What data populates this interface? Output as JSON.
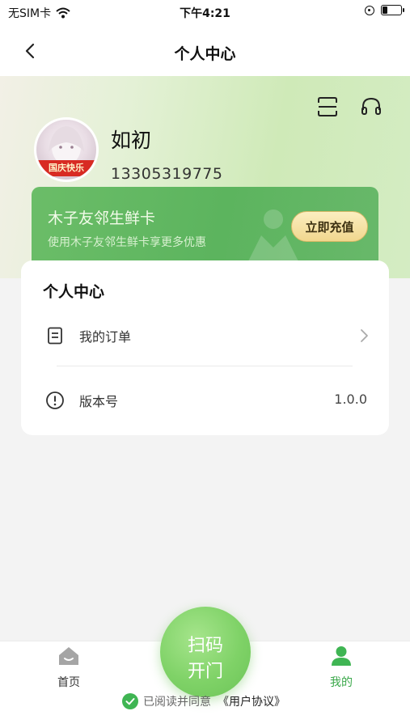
{
  "status_bar": {
    "carrier": "无SIM卡",
    "time": "下午4:21",
    "battery_level": 0.3,
    "icons": [
      "wifi-icon",
      "orientation-lock-icon",
      "battery-icon"
    ]
  },
  "nav": {
    "title": "个人中心",
    "back_icon": "chevron-left-icon"
  },
  "header": {
    "icons": [
      "scan-frame-icon",
      "headset-icon"
    ],
    "gradient_colors": [
      "#f2f0e6",
      "#cfeab8"
    ]
  },
  "user": {
    "name": "如初",
    "phone": "13305319775",
    "avatar_banner": "国庆快乐"
  },
  "card": {
    "title": "木子友邻生鲜卡",
    "subtitle": "使用木子友邻生鲜卡享更多优惠",
    "button_label": "立即充值",
    "color": "#5cb45e"
  },
  "panel": {
    "title": "个人中心",
    "rows": [
      {
        "label": "我的订单",
        "icon": "document-icon",
        "value": "",
        "chevron": true
      },
      {
        "label": "版本号",
        "icon": "info-circle-icon",
        "value": "1.0.0",
        "chevron": false
      }
    ]
  },
  "tab_bar": {
    "tabs": [
      {
        "label": "首页",
        "icon": "home-icon",
        "active": false
      },
      {
        "label": "我的",
        "icon": "person-icon",
        "active": true
      }
    ],
    "scan_button": {
      "line1": "扫码",
      "line2": "开门"
    },
    "active_color": "#3aa84a"
  },
  "agreement": {
    "text": "已阅读并同意",
    "link": "《用户协议》",
    "checked": true
  }
}
